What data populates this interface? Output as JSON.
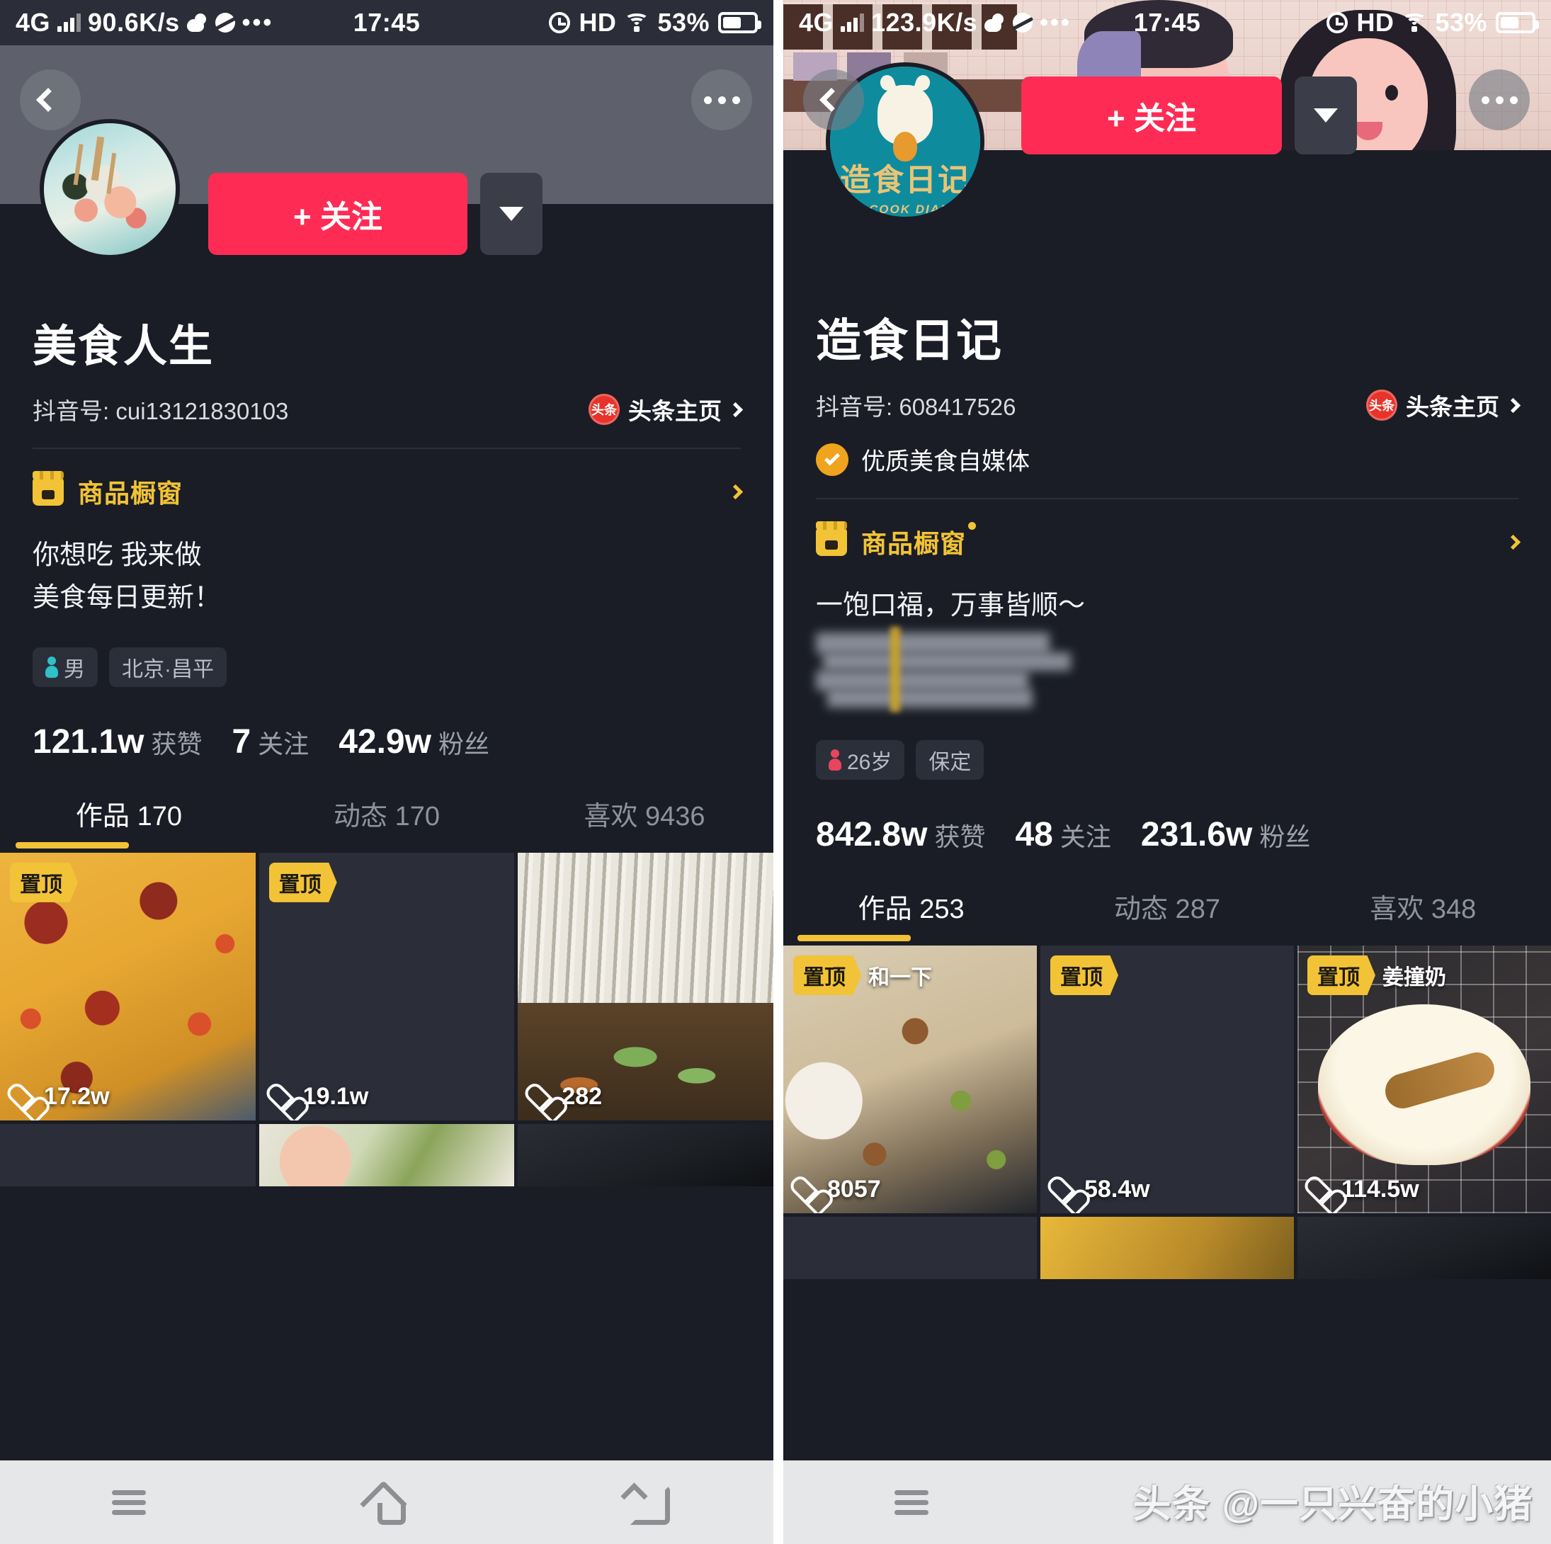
{
  "colors": {
    "app_bg": "#1a1d26",
    "accent_red": "#fe2c55",
    "accent_yellow": "#f2c336",
    "verify_orange": "#f0a31c",
    "status_bar_bg": "#2b2e38",
    "android_nav_bg": "#e6e7e8"
  },
  "watermark": "头条 @一只兴奋的小猪",
  "left": {
    "status_bar": {
      "network": "4G",
      "speed": "90.6K/s",
      "weather_icon": "cloudy-icon",
      "planet_icon": "planet-icon",
      "overflow_icon": "ellipsis-icon",
      "time": "17:45",
      "alarm_icon": "alarm-clock-icon",
      "hd": "HD",
      "wifi_icon": "wifi-icon",
      "battery_percent": "53%",
      "battery_icon": "battery-icon"
    },
    "nav": {
      "back_icon": "chevron-left-icon",
      "more_icon": "ellipsis-icon"
    },
    "avatar_name": "food-platter-avatar",
    "follow_button": "+ 关注",
    "follow_more_icon": "chevron-down-icon",
    "nickname": "美食人生",
    "uid": "抖音号: cui13121830103",
    "toutiao": {
      "badge": "头条",
      "label": "头条主页",
      "chev_icon": "chevron-right-icon"
    },
    "shop": {
      "icon": "shop-window-icon",
      "label": "商品橱窗",
      "chev_icon": "chevron-right-icon"
    },
    "bio_line1": "你想吃  我来做",
    "bio_line2": "美食每日更新！",
    "tags": [
      {
        "icon": "person-icon",
        "label": "男",
        "icon_color": "#2fc0c8"
      },
      {
        "icon": "",
        "label": "北京·昌平",
        "icon_color": ""
      }
    ],
    "stats": [
      {
        "value": "121.1w",
        "label": "获赞"
      },
      {
        "value": "7",
        "label": "关注"
      },
      {
        "value": "42.9w",
        "label": "粉丝"
      }
    ],
    "tabs": [
      {
        "label": "作品 170",
        "active": true
      },
      {
        "label": "动态 170",
        "active": false
      },
      {
        "label": "喜欢 9436",
        "active": false
      }
    ],
    "videos": [
      {
        "thumb": "th-rice",
        "pin": "置顶",
        "caption": "",
        "likes": "17.2w"
      },
      {
        "thumb": "th-dark",
        "pin": "置顶",
        "caption": "",
        "likes": "19.1w"
      },
      {
        "thumb": "th-noodle",
        "pin": "",
        "caption": "",
        "likes": "282"
      }
    ],
    "videos_row2": [
      {
        "thumb": "th-dark"
      },
      {
        "thumb": "th-hand"
      },
      {
        "thumb": "th-pan"
      }
    ]
  },
  "right": {
    "status_bar": {
      "network": "4G",
      "speed": "123.9K/s",
      "weather_icon": "cloudy-icon",
      "planet_icon": "planet-icon",
      "overflow_icon": "ellipsis-icon",
      "time": "17:45",
      "alarm_icon": "alarm-clock-icon",
      "hd": "HD",
      "wifi_icon": "wifi-icon",
      "battery_percent": "53%",
      "battery_icon": "battery-icon"
    },
    "nav": {
      "back_icon": "chevron-left-icon",
      "more_icon": "ellipsis-icon"
    },
    "avatar_logo": {
      "cn": "造食日记",
      "en": "THE COOK DIARIES",
      "bg": "#0f8b9e",
      "text": "#e9c477"
    },
    "follow_button": "+ 关注",
    "follow_more_icon": "chevron-down-icon",
    "nickname": "造食日记",
    "uid": "抖音号: 608417526",
    "toutiao": {
      "badge": "头条",
      "label": "头条主页",
      "chev_icon": "chevron-right-icon"
    },
    "verified": {
      "icon": "check-badge-icon",
      "label": "优质美食自媒体"
    },
    "shop": {
      "icon": "shop-window-icon",
      "label": "商品橱窗",
      "chev_icon": "chevron-right-icon",
      "has_dot": true
    },
    "bio_line1": "一饱口福，万事皆顺～",
    "bio_blurred": true,
    "tags": [
      {
        "icon": "person-icon",
        "label": "26岁",
        "icon_color": "#e8455f"
      },
      {
        "icon": "",
        "label": "保定",
        "icon_color": ""
      }
    ],
    "stats": [
      {
        "value": "842.8w",
        "label": "获赞"
      },
      {
        "value": "48",
        "label": "关注"
      },
      {
        "value": "231.6w",
        "label": "粉丝"
      }
    ],
    "tabs": [
      {
        "label": "作品 253",
        "active": true
      },
      {
        "label": "动态 287",
        "active": false
      },
      {
        "label": "喜欢 348",
        "active": false
      }
    ],
    "videos": [
      {
        "thumb": "th-friedrice",
        "pin": "置顶",
        "caption": "和一下",
        "likes": "8057"
      },
      {
        "thumb": "th-dark",
        "pin": "置顶",
        "caption": "",
        "likes": "58.4w"
      },
      {
        "thumb": "th-milk",
        "pin": "置顶",
        "caption": "姜撞奶",
        "likes": "114.5w"
      }
    ],
    "videos_row2": [
      {
        "thumb": "th-dark"
      },
      {
        "thumb": "th-yellow"
      },
      {
        "thumb": "th-pan"
      }
    ]
  },
  "android_nav": {
    "menu_icon": "menu-icon",
    "home_icon": "home-icon",
    "back_icon": "back-arrow-icon"
  }
}
